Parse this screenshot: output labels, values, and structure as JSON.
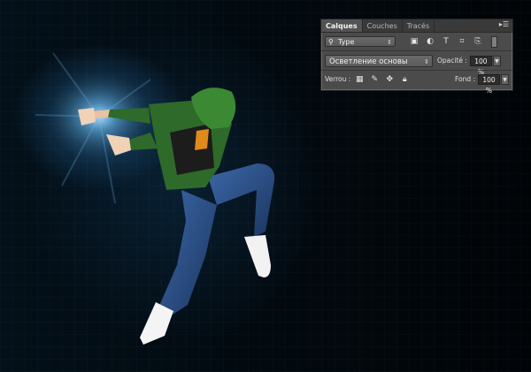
{
  "panel": {
    "tabs": [
      {
        "label": "Calques",
        "active": true
      },
      {
        "label": "Couches",
        "active": false
      },
      {
        "label": "Tracés",
        "active": false
      }
    ],
    "menu_icon": "panel-menu-icon",
    "filter": {
      "label": "Type",
      "icon": "search-icon"
    },
    "filter_icons": [
      "pixel-layer-filter-icon",
      "adjustment-layer-filter-icon",
      "type-layer-filter-icon",
      "shape-layer-filter-icon",
      "smart-object-filter-icon"
    ],
    "blend_mode": "Осветление основы",
    "opacity": {
      "label": "Opacité :",
      "value": "100 %"
    },
    "lock": {
      "label": "Verrou :",
      "icons": [
        "lock-transparent-pixels-icon",
        "lock-image-pixels-icon",
        "lock-position-icon",
        "lock-all-icon"
      ]
    },
    "fill": {
      "label": "Fond :",
      "value": "100 %"
    }
  },
  "colors": {
    "panel_bg": "#4b4b4b",
    "canvas_bg": "#02060a",
    "glow": "#78c8ff",
    "hoodie": "#2f6b2a",
    "jeans": "#2a4f87"
  }
}
